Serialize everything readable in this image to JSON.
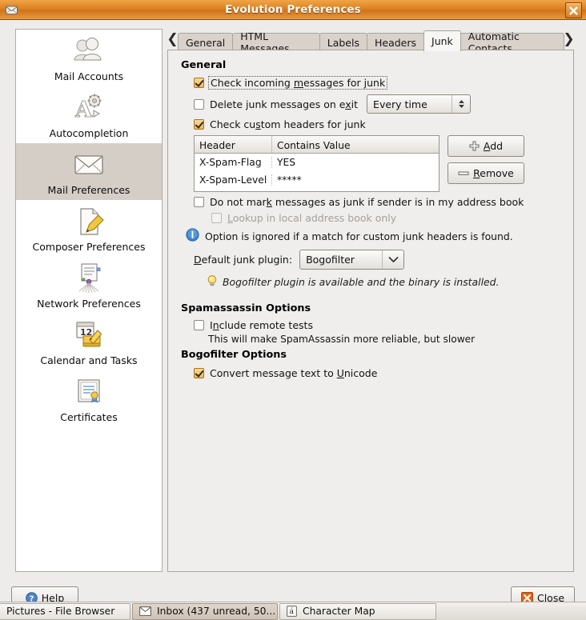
{
  "window": {
    "title": "Evolution Preferences",
    "icon": "envelope-icon",
    "close_label": "x"
  },
  "sidebar": {
    "items": [
      {
        "label": "Mail Accounts",
        "icon": "users-icon",
        "selected": false
      },
      {
        "label": "Autocompletion",
        "icon": "autocomplete-icon",
        "selected": false
      },
      {
        "label": "Mail Preferences",
        "icon": "envelope-icon",
        "selected": true
      },
      {
        "label": "Composer Preferences",
        "icon": "compose-pencil-icon",
        "selected": false
      },
      {
        "label": "Network Preferences",
        "icon": "network-document-icon",
        "selected": false
      },
      {
        "label": "Calendar and Tasks",
        "icon": "calendar-pencil-icon",
        "selected": false
      },
      {
        "label": "Certificates",
        "icon": "certificate-icon",
        "selected": false
      }
    ]
  },
  "tabs": {
    "prev_arrow": "❮",
    "next_arrow": "❯",
    "items": [
      {
        "label": "General",
        "active": false
      },
      {
        "label": "HTML Messages",
        "active": false
      },
      {
        "label": "Labels",
        "active": false
      },
      {
        "label": "Headers",
        "active": false
      },
      {
        "label": "Junk",
        "active": true
      },
      {
        "label": "Automatic Contacts",
        "active": false
      }
    ]
  },
  "junk": {
    "general_group_title": "General",
    "check_incoming": {
      "label_pre": "Check incoming ",
      "label_mnemonic": "m",
      "label_post": "essages for junk",
      "checked": true,
      "focused": true
    },
    "delete_on_exit": {
      "label_pre": "Delete junk messages on e",
      "label_mnemonic": "x",
      "label_post": "it",
      "checked": false
    },
    "delete_on_exit_value": "Every time",
    "check_custom_headers": {
      "label_pre": "Check cu",
      "label_mnemonic": "s",
      "label_post": "tom headers for junk",
      "checked": true
    },
    "headers_table": {
      "columns": [
        "Header",
        "Contains Value"
      ],
      "rows": [
        [
          "X-Spam-Flag",
          "YES"
        ],
        [
          "X-Spam-Level",
          "*****"
        ]
      ]
    },
    "add_button": {
      "label_pre": "",
      "label_mnemonic": "A",
      "label_post": "dd",
      "icon": "plus-icon"
    },
    "remove_button": {
      "label_pre": "",
      "label_mnemonic": "R",
      "label_post": "emove",
      "icon": "minus-icon"
    },
    "do_not_mark": {
      "label_pre": "Do not mar",
      "label_mnemonic": "k",
      "label_post": " messages as junk if sender is in my address book",
      "checked": false
    },
    "lookup_local": {
      "label_pre": "",
      "label_mnemonic": "L",
      "label_post": "ookup in local address book only",
      "checked": false,
      "disabled": true
    },
    "info_note": "Option is ignored if a match for custom junk headers is found.",
    "info_icon": "info-icon",
    "default_plugin_label_pre": "",
    "default_plugin_label_mnemonic": "D",
    "default_plugin_label_post": "efault junk plugin:",
    "default_plugin_value": "Bogofilter",
    "plugin_hint": "Bogofilter plugin is available and the binary is installed.",
    "plugin_hint_icon": "lightbulb-icon",
    "spamassassin_group_title": "Spamassassin Options",
    "include_remote_tests": {
      "label_pre": "I",
      "label_mnemonic": "n",
      "label_post": "clude remote tests",
      "checked": false
    },
    "remote_tests_note": "This will make SpamAssassin more reliable, but slower",
    "bogofilter_group_title": "Bogofilter Options",
    "convert_unicode": {
      "label_pre": "Convert message text to ",
      "label_mnemonic": "U",
      "label_post": "nicode",
      "checked": true
    }
  },
  "dialog_buttons": {
    "help": {
      "label": "Help",
      "icon": "help-icon"
    },
    "close": {
      "label": "Close",
      "icon": "close-x-icon"
    }
  },
  "taskbar": {
    "items": [
      {
        "label": "Pictures - File Browser",
        "icon": "none",
        "active": false
      },
      {
        "label": "Inbox (437 unread, 50...",
        "icon": "envelope-icon",
        "active": true
      },
      {
        "label": "Character Map",
        "icon": "charmap-icon",
        "active": false
      }
    ]
  },
  "colors": {
    "titlebar_orange": "#dc8125",
    "checkbox_checked": "#f5b94e",
    "selection_gray": "#d5cec6",
    "panel_bg": "#efeeec"
  }
}
